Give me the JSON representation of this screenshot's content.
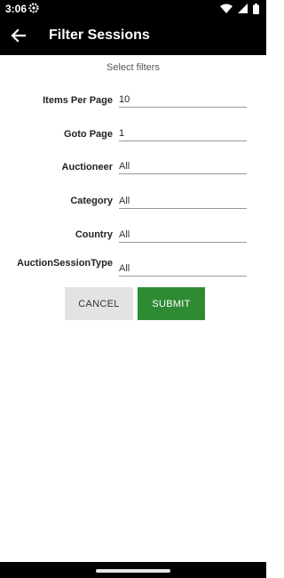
{
  "status_bar": {
    "time": "3:06"
  },
  "app_bar": {
    "title": "Filter Sessions",
    "back_icon": "arrow-left-icon"
  },
  "subtitle": "Select filters",
  "form": {
    "items_per_page": {
      "label": "Items Per Page",
      "value": "10"
    },
    "goto_page": {
      "label": "Goto Page",
      "value": "1"
    },
    "auctioneer": {
      "label": "Auctioneer",
      "value": "All"
    },
    "category": {
      "label": "Category",
      "value": "All"
    },
    "country": {
      "label": "Country",
      "value": "All"
    },
    "auction_session_type": {
      "label": "AuctionSessionType",
      "value": "All"
    }
  },
  "buttons": {
    "cancel": "CANCEL",
    "submit": "SUBMIT"
  },
  "colors": {
    "app_bar": "#000000",
    "submit": "#2e8b34",
    "cancel": "#e3e3e3"
  }
}
